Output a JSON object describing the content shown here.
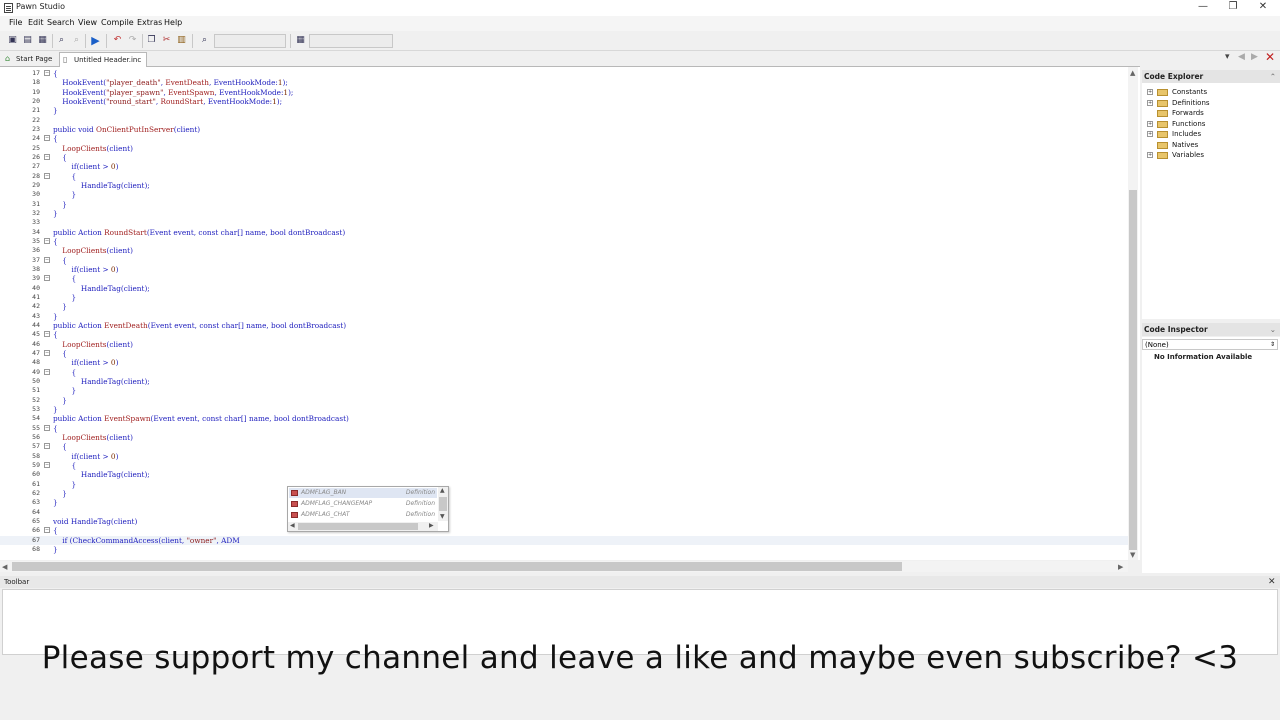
{
  "window": {
    "title": "Pawn Studio",
    "minimize": "—",
    "restore": "❐",
    "close": "✕"
  },
  "menu": [
    "File",
    "Edit",
    "Search",
    "View",
    "Compile",
    "Extras",
    "Help"
  ],
  "tabs": [
    {
      "label": "Start Page",
      "active": false
    },
    {
      "label": "Untitled Header.inc",
      "active": true
    }
  ],
  "editor": {
    "lines": [
      {
        "n": "17",
        "text": "{"
      },
      {
        "n": "18",
        "text": "    HookEvent(\"player_death\", EventDeath, EventHookMode:1);"
      },
      {
        "n": "19",
        "text": "    HookEvent(\"player_spawn\", EventSpawn, EventHookMode:1);"
      },
      {
        "n": "20",
        "text": "    HookEvent(\"round_start\", RoundStart, EventHookMode:1);"
      },
      {
        "n": "21",
        "text": "}"
      },
      {
        "n": "22",
        "text": ""
      },
      {
        "n": "23",
        "text": "public void OnClientPutInServer(client)"
      },
      {
        "n": "24",
        "text": "{"
      },
      {
        "n": "25",
        "text": "    LoopClients(client)"
      },
      {
        "n": "26",
        "text": "    {"
      },
      {
        "n": "27",
        "text": "        if(client > 0)"
      },
      {
        "n": "28",
        "text": "        {"
      },
      {
        "n": "29",
        "text": "            HandleTag(client);"
      },
      {
        "n": "30",
        "text": "        }"
      },
      {
        "n": "31",
        "text": "    }"
      },
      {
        "n": "32",
        "text": "}"
      },
      {
        "n": "33",
        "text": ""
      },
      {
        "n": "34",
        "text": "public Action RoundStart(Event event, const char[] name, bool dontBroadcast)"
      },
      {
        "n": "35",
        "text": "{"
      },
      {
        "n": "36",
        "text": "    LoopClients(client)"
      },
      {
        "n": "37",
        "text": "    {"
      },
      {
        "n": "38",
        "text": "        if(client > 0)"
      },
      {
        "n": "39",
        "text": "        {"
      },
      {
        "n": "40",
        "text": "            HandleTag(client);"
      },
      {
        "n": "41",
        "text": "        }"
      },
      {
        "n": "42",
        "text": "    }"
      },
      {
        "n": "43",
        "text": "}"
      },
      {
        "n": "44",
        "text": "public Action EventDeath(Event event, const char[] name, bool dontBroadcast)"
      },
      {
        "n": "45",
        "text": "{"
      },
      {
        "n": "46",
        "text": "    LoopClients(client)"
      },
      {
        "n": "47",
        "text": "    {"
      },
      {
        "n": "48",
        "text": "        if(client > 0)"
      },
      {
        "n": "49",
        "text": "        {"
      },
      {
        "n": "50",
        "text": "            HandleTag(client);"
      },
      {
        "n": "51",
        "text": "        }"
      },
      {
        "n": "52",
        "text": "    }"
      },
      {
        "n": "53",
        "text": "}"
      },
      {
        "n": "54",
        "text": "public Action EventSpawn(Event event, const char[] name, bool dontBroadcast)"
      },
      {
        "n": "55",
        "text": "{"
      },
      {
        "n": "56",
        "text": "    LoopClients(client)"
      },
      {
        "n": "57",
        "text": "    {"
      },
      {
        "n": "58",
        "text": "        if(client > 0)"
      },
      {
        "n": "59",
        "text": "        {"
      },
      {
        "n": "60",
        "text": "            HandleTag(client);"
      },
      {
        "n": "61",
        "text": "        }"
      },
      {
        "n": "62",
        "text": "    }"
      },
      {
        "n": "63",
        "text": "}"
      },
      {
        "n": "64",
        "text": ""
      },
      {
        "n": "65",
        "text": "void HandleTag(client)"
      },
      {
        "n": "66",
        "text": "{"
      },
      {
        "n": "67",
        "text": "    if (CheckCommandAccess(client, \"owner\", ADM"
      },
      {
        "n": "68",
        "text": "}"
      }
    ],
    "current_line": "67"
  },
  "autocomplete": {
    "items": [
      {
        "name": "ADMFLAG_BAN",
        "type": "Definition",
        "selected": true
      },
      {
        "name": "ADMFLAG_CHANGEMAP",
        "type": "Definition",
        "selected": false
      },
      {
        "name": "ADMFLAG_CHAT",
        "type": "Definition",
        "selected": false
      }
    ]
  },
  "code_explorer": {
    "title": "Code Explorer",
    "items": [
      "Constants",
      "Definitions",
      "Forwards",
      "Functions",
      "Includes",
      "Natives",
      "Variables"
    ]
  },
  "code_inspector": {
    "title": "Code Inspector",
    "selected": "(None)",
    "message": "No Information Available"
  },
  "bottom_panel": {
    "title": "Toolbar",
    "close": "✕"
  },
  "overlay_text": "Please support my channel and leave a like and maybe even subscribe? <3"
}
